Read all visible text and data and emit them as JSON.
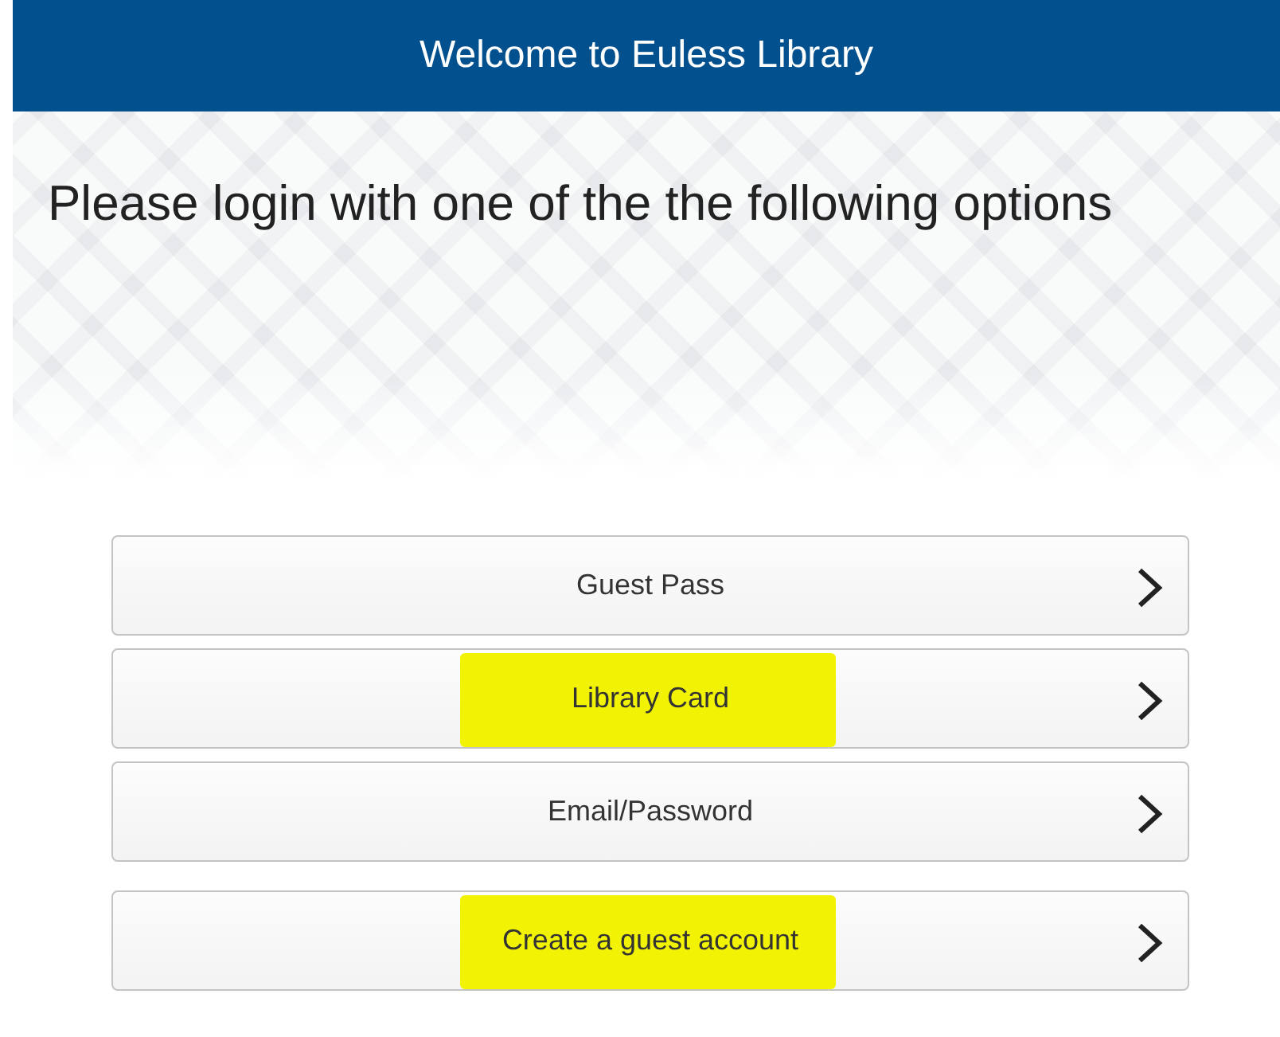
{
  "header": {
    "title": "Welcome to Euless Library"
  },
  "heading": "Please login with one of the the following options",
  "options": [
    {
      "kind": "login",
      "label": "Guest Pass",
      "highlighted": false
    },
    {
      "kind": "login",
      "label": "Library Card",
      "highlighted": true
    },
    {
      "kind": "login",
      "label": "Email/Password",
      "highlighted": false
    },
    {
      "kind": "signup",
      "label": "Create a guest account",
      "highlighted": true
    }
  ]
}
